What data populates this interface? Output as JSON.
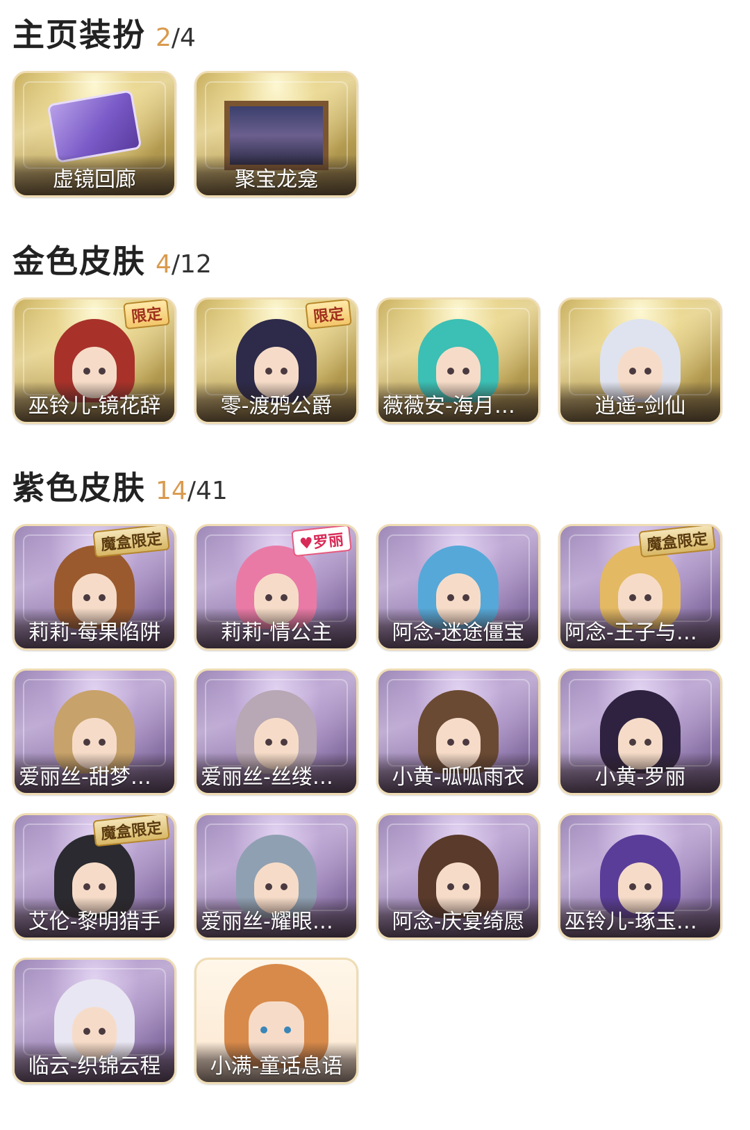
{
  "sections": [
    {
      "title": "主页装扮",
      "owned": "2",
      "total": "4",
      "items": [
        {
          "name": "虚镜回廊",
          "icon": "ticket-icon"
        },
        {
          "name": "聚宝龙龛",
          "icon": "painting-icon"
        }
      ]
    },
    {
      "title": "金色皮肤",
      "owned": "4",
      "total": "12",
      "items": [
        {
          "name": "巫铃儿-镜花辞",
          "badge": "限定"
        },
        {
          "name": "零-渡鸦公爵",
          "badge": "限定"
        },
        {
          "name": "薇薇安-海月息..."
        },
        {
          "name": "逍遥-剑仙"
        }
      ]
    },
    {
      "title": "紫色皮肤",
      "owned": "14",
      "total": "41",
      "items": [
        {
          "name": "莉莉-莓果陷阱",
          "badge": "魔盒限定"
        },
        {
          "name": "莉莉-情公主",
          "badge": "♥罗丽"
        },
        {
          "name": "阿念-迷途僵宝"
        },
        {
          "name": "阿念-王子与骑...",
          "badge": "魔盒限定"
        },
        {
          "name": "爱丽丝-甜梦派..."
        },
        {
          "name": "爱丽丝-丝缕哀..."
        },
        {
          "name": "小黄-呱呱雨衣"
        },
        {
          "name": "小黄-罗丽"
        },
        {
          "name": "艾伦-黎明猎手",
          "badge": "魔盒限定"
        },
        {
          "name": "爱丽丝-耀眼的..."
        },
        {
          "name": "阿念-庆宴绮愿"
        },
        {
          "name": "巫铃儿-琢玉怀..."
        },
        {
          "name": "临云-织锦云程"
        },
        {
          "name": "小满-童话息语"
        }
      ]
    }
  ],
  "colors": {
    "owned_count": "#d99a4e",
    "gold_card": "#c9b060",
    "purple_card": "#9a86b4",
    "card_border": "#efdcb3"
  }
}
